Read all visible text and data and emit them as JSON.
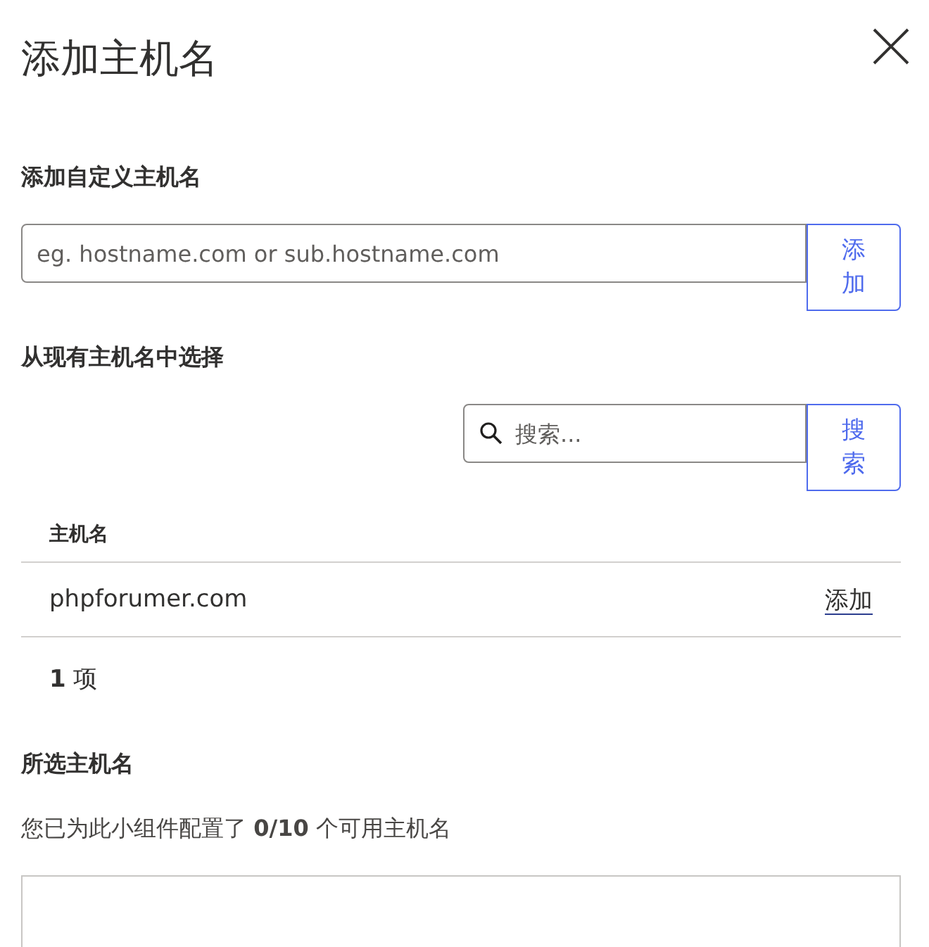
{
  "dialog": {
    "title": "添加主机名"
  },
  "custom_hostname": {
    "heading": "添加自定义主机名",
    "placeholder": "eg. hostname.com or sub.hostname.com",
    "button": "添加"
  },
  "existing": {
    "heading": "从现有主机名中选择",
    "search_placeholder": "搜索...",
    "search_button": "搜索",
    "table": {
      "columns": [
        "主机名"
      ],
      "rows": [
        {
          "hostname": "phpforumer.com",
          "action": "添加"
        }
      ]
    },
    "count": "**1** 项"
  },
  "selected": {
    "heading": "所选主机名",
    "summary": "您已为此小组件配置了 **0/10** 个可用主机名"
  }
}
